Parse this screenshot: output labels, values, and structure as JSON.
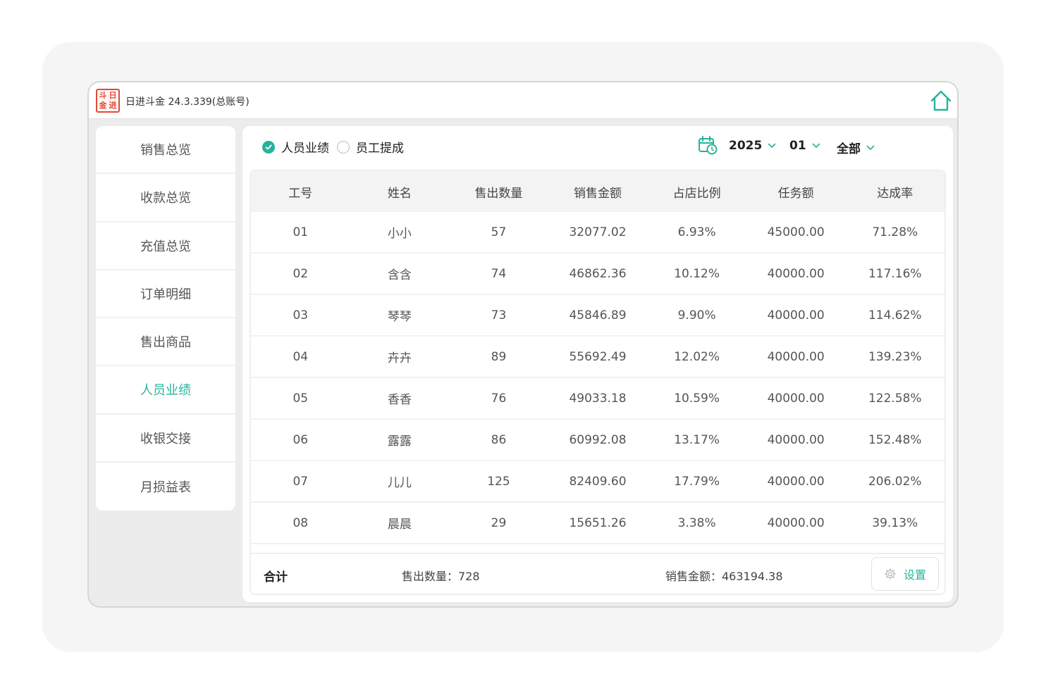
{
  "app": {
    "title": "日进斗金 24.3.339(总账号)",
    "logo_chars": [
      "斗",
      "日",
      "金",
      "进"
    ]
  },
  "colors": {
    "accent": "#26b39b",
    "logo_red": "#e04b3a"
  },
  "sidebar": {
    "items": [
      {
        "label": "销售总览",
        "active": false
      },
      {
        "label": "收款总览",
        "active": false
      },
      {
        "label": "充值总览",
        "active": false
      },
      {
        "label": "订单明细",
        "active": false
      },
      {
        "label": "售出商品",
        "active": false
      },
      {
        "label": "人员业绩",
        "active": true
      },
      {
        "label": "收银交接",
        "active": false
      },
      {
        "label": "月损益表",
        "active": false
      }
    ]
  },
  "filters": {
    "radio_performance": "人员业绩",
    "radio_commission": "员工提成",
    "year": "2025",
    "month": "01",
    "scope": "全部"
  },
  "table": {
    "headers": [
      "工号",
      "姓名",
      "售出数量",
      "销售金额",
      "占店比例",
      "任务额",
      "达成率"
    ],
    "rows": [
      [
        "01",
        "小小",
        "57",
        "32077.02",
        "6.93%",
        "45000.00",
        "71.28%"
      ],
      [
        "02",
        "含含",
        "74",
        "46862.36",
        "10.12%",
        "40000.00",
        "117.16%"
      ],
      [
        "03",
        "琴琴",
        "73",
        "45846.89",
        "9.90%",
        "40000.00",
        "114.62%"
      ],
      [
        "04",
        "卉卉",
        "89",
        "55692.49",
        "12.02%",
        "40000.00",
        "139.23%"
      ],
      [
        "05",
        "香香",
        "76",
        "49033.18",
        "10.59%",
        "40000.00",
        "122.58%"
      ],
      [
        "06",
        "露露",
        "86",
        "60992.08",
        "13.17%",
        "40000.00",
        "152.48%"
      ],
      [
        "07",
        "儿儿",
        "125",
        "82409.60",
        "17.79%",
        "40000.00",
        "206.02%"
      ],
      [
        "08",
        "晨晨",
        "29",
        "15651.26",
        "3.38%",
        "40000.00",
        "39.13%"
      ]
    ]
  },
  "footer": {
    "total_label": "合计",
    "qty_text": "售出数量：728",
    "amount_text": "销售金额：463194.38",
    "settings_label": "设置"
  }
}
